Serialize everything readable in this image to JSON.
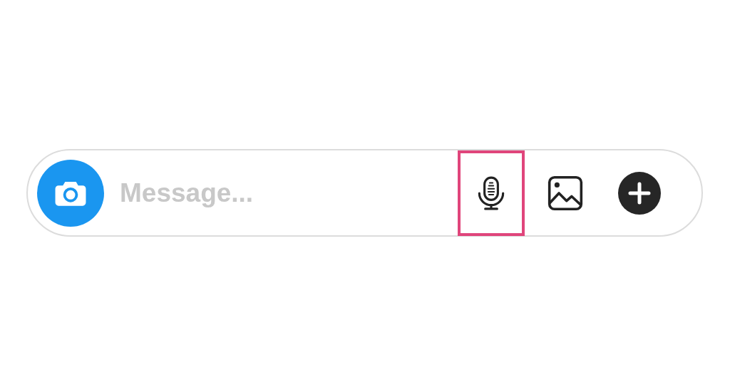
{
  "composer": {
    "placeholder": "Message...",
    "actions": [
      {
        "kind": "microphone",
        "highlighted": true
      },
      {
        "kind": "gallery",
        "highlighted": false
      },
      {
        "kind": "add",
        "highlighted": false
      }
    ]
  }
}
